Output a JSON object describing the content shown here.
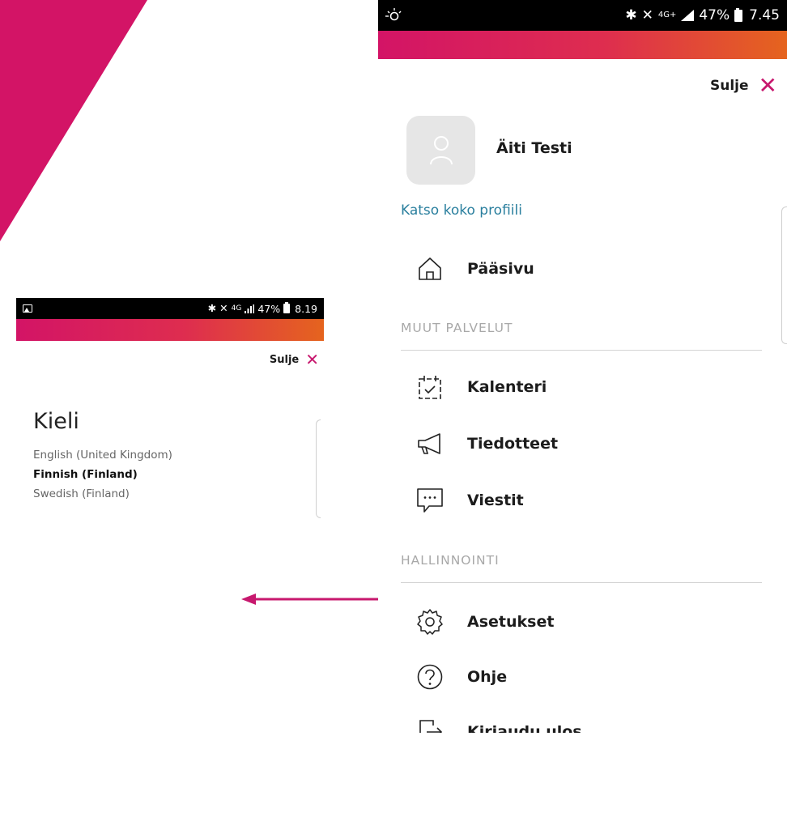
{
  "colors": {
    "accent": "#c7186e",
    "gradient_start": "#d31466",
    "gradient_end": "#e5641e",
    "link": "#2a7f9e",
    "section_header": "#a8a8a8"
  },
  "left_screen": {
    "status_bar": {
      "left_icon": "gallery-icon",
      "icons": [
        "bluetooth-icon",
        "mute-icon",
        "network-4g-icon",
        "signal-icon"
      ],
      "network_text": "4G",
      "battery_percent": "47%",
      "time": "8.19"
    },
    "close_label": "Sulje",
    "language": {
      "title": "Kieli",
      "options": [
        {
          "label": "English (United Kingdom)",
          "selected": false
        },
        {
          "label": "Finnish (Finland)",
          "selected": true
        },
        {
          "label": "Swedish (Finland)",
          "selected": false
        }
      ]
    }
  },
  "right_screen": {
    "status_bar": {
      "left_icon": "brightness-icon",
      "icons": [
        "bluetooth-icon",
        "mute-icon",
        "network-4g-icon",
        "signal-icon"
      ],
      "network_text": "4G+",
      "battery_percent": "47%",
      "time": "7.45"
    },
    "close_label": "Sulje",
    "profile": {
      "name": "Äiti Testi",
      "link": "Katso koko profiili",
      "avatar_icon": "user-icon"
    },
    "menu": {
      "home": {
        "label": "Pääsivu",
        "icon": "home-icon"
      },
      "section_other": {
        "title": "MUUT PALVELUT",
        "items": [
          {
            "label": "Kalenteri",
            "icon": "calendar-icon"
          },
          {
            "label": "Tiedotteet",
            "icon": "megaphone-icon"
          },
          {
            "label": "Viestit",
            "icon": "message-icon"
          }
        ]
      },
      "section_admin": {
        "title": "HALLINNOINTI",
        "items": [
          {
            "label": "Asetukset",
            "icon": "gear-icon"
          },
          {
            "label": "Ohje",
            "icon": "help-icon"
          },
          {
            "label": "Kirjaudu ulos",
            "icon": "logout-icon"
          }
        ]
      }
    }
  }
}
